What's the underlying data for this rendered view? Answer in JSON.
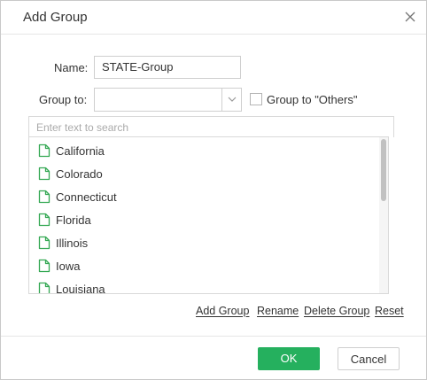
{
  "dialog": {
    "title": "Add Group"
  },
  "form": {
    "name_label": "Name:",
    "name_value": "STATE-Group",
    "group_to_label": "Group to:",
    "group_to_value": "",
    "others_checkbox_label": "Group to \"Others\"",
    "others_checked": false
  },
  "search": {
    "placeholder": "Enter text to search"
  },
  "list": {
    "items": [
      {
        "label": "California"
      },
      {
        "label": "Colorado"
      },
      {
        "label": "Connecticut"
      },
      {
        "label": "Florida"
      },
      {
        "label": "Illinois"
      },
      {
        "label": "Iowa"
      },
      {
        "label": "Louisiana"
      }
    ]
  },
  "actions": {
    "add_group": "Add Group",
    "rename": "Rename",
    "delete_group": "Delete Group",
    "reset": "Reset"
  },
  "footer": {
    "ok_label": "OK",
    "cancel_label": "Cancel"
  },
  "colors": {
    "accent_green": "#25b05e",
    "doc_icon_green": "#34a853"
  }
}
